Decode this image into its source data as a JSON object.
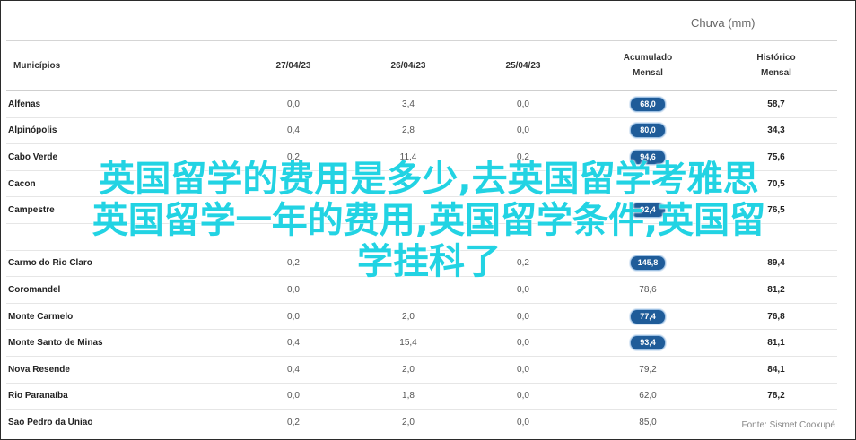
{
  "chart_title": "Chuva (mm)",
  "headers": {
    "municipios": "Municípios",
    "d1": "27/04/23",
    "d2": "26/04/23",
    "d3": "25/04/23",
    "acc_line1": "Acumulado",
    "acc_line2": "Mensal",
    "hist_line1": "Histórico",
    "hist_line2": "Mensal"
  },
  "rows": [
    {
      "name": "Alfenas",
      "d1": "0,0",
      "d2": "3,4",
      "d3": "0,0",
      "acc": "68,0",
      "acc_pill": true,
      "hist": "58,7"
    },
    {
      "name": "Alpinópolis",
      "d1": "0,4",
      "d2": "2,8",
      "d3": "0,0",
      "acc": "80,0",
      "acc_pill": true,
      "hist": "34,3"
    },
    {
      "name": "Cabo Verde",
      "d1": "0,2",
      "d2": "11,4",
      "d3": "0,2",
      "acc": "94,6",
      "acc_pill": true,
      "hist": "75,6"
    },
    {
      "name": "Cacon",
      "d1": "",
      "d2": "",
      "d3": "",
      "acc": "",
      "acc_pill": true,
      "hist": "70,5"
    },
    {
      "name": "Campestre",
      "d1": "",
      "d2": "",
      "d3": "",
      "acc": "92,4",
      "acc_pill": true,
      "hist": "76,5"
    },
    {
      "name": "",
      "d1": "",
      "d2": "",
      "d3": "",
      "acc": "",
      "acc_pill": true,
      "hist": ""
    },
    {
      "name": "Carmo do Rio Claro",
      "d1": "0,2",
      "d2": "",
      "d3": "0,2",
      "acc": "145,8",
      "acc_pill": true,
      "hist": "89,4"
    },
    {
      "name": "Coromandel",
      "d1": "0,0",
      "d2": "",
      "d3": "0,0",
      "acc": "78,6",
      "acc_pill": false,
      "hist": "81,2"
    },
    {
      "name": "Monte Carmelo",
      "d1": "0,0",
      "d2": "2,0",
      "d3": "0,0",
      "acc": "77,4",
      "acc_pill": true,
      "hist": "76,8"
    },
    {
      "name": "Monte Santo de Minas",
      "d1": "0,4",
      "d2": "15,4",
      "d3": "0,0",
      "acc": "93,4",
      "acc_pill": true,
      "hist": "81,1"
    },
    {
      "name": "Nova Resende",
      "d1": "0,4",
      "d2": "2,0",
      "d3": "0,0",
      "acc": "79,2",
      "acc_pill": false,
      "hist": "84,1"
    },
    {
      "name": "Rio Paranaíba",
      "d1": "0,0",
      "d2": "1,8",
      "d3": "0,0",
      "acc": "62,0",
      "acc_pill": false,
      "hist": "78,2"
    },
    {
      "name": "Sao Pedro da Uniao",
      "d1": "0,2",
      "d2": "2,0",
      "d3": "0,0",
      "acc": "85,0",
      "acc_pill": false,
      "hist": ""
    }
  ],
  "source": "Fonte: Sismet Cooxupé",
  "overlay_lines": [
    "英国留学的费用是多少,去英国留学考雅思",
    "英国留学一年的费用,英国留学条件,英国留",
    "学挂科了"
  ],
  "colors": {
    "pill": "#1f5c99",
    "overlay": "#22d3e3"
  }
}
